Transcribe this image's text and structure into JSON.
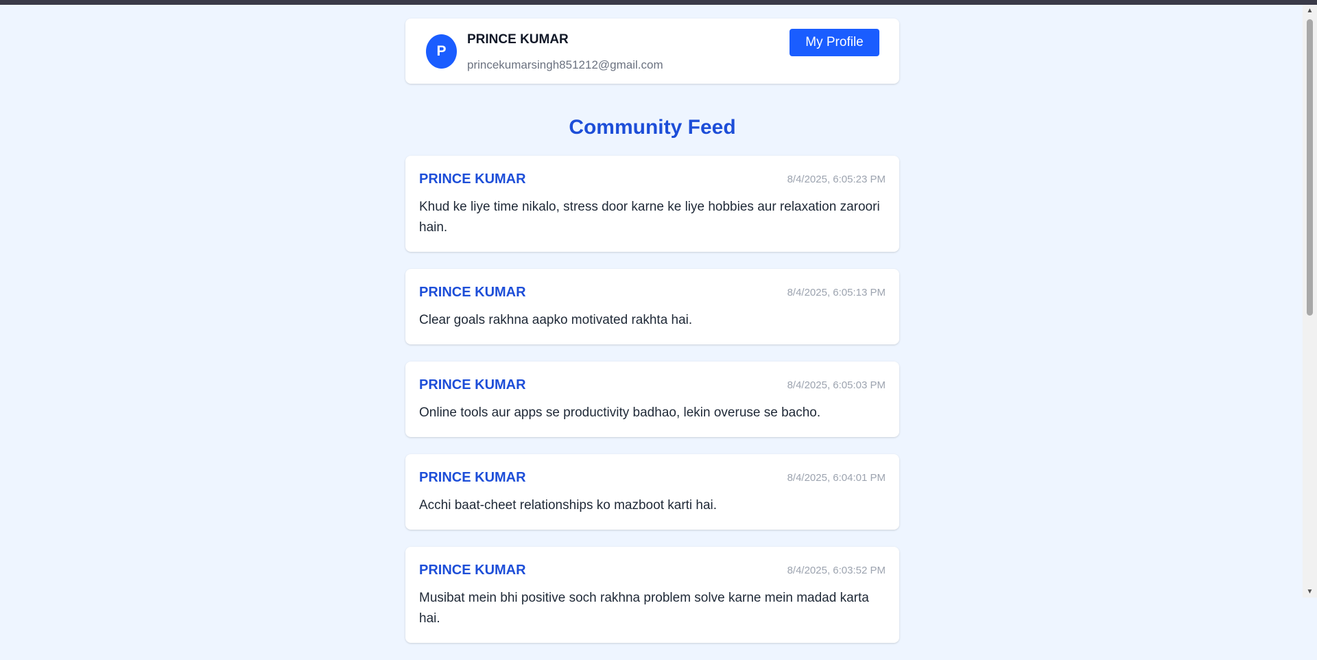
{
  "profile": {
    "avatar_initial": "P",
    "name": "PRINCE KUMAR",
    "email": "princekumarsingh851212@gmail.com",
    "button_label": "My Profile"
  },
  "feed": {
    "title": "Community Feed",
    "posts": [
      {
        "author": "PRINCE KUMAR",
        "timestamp": "8/4/2025, 6:05:23 PM",
        "content": "Khud ke liye time nikalo, stress door karne ke liye hobbies aur relaxation zaroori hain."
      },
      {
        "author": "PRINCE KUMAR",
        "timestamp": "8/4/2025, 6:05:13 PM",
        "content": "Clear goals rakhna aapko motivated rakhta hai."
      },
      {
        "author": "PRINCE KUMAR",
        "timestamp": "8/4/2025, 6:05:03 PM",
        "content": "Online tools aur apps se productivity badhao, lekin overuse se bacho."
      },
      {
        "author": "PRINCE KUMAR",
        "timestamp": "8/4/2025, 6:04:01 PM",
        "content": "Acchi baat-cheet relationships ko mazboot karti hai."
      },
      {
        "author": "PRINCE KUMAR",
        "timestamp": "8/4/2025, 6:03:52 PM",
        "content": "Musibat mein bhi positive soch rakhna problem solve karne mein madad karta hai."
      }
    ]
  },
  "icons": {
    "scroll_up": "scroll-up-arrow-icon",
    "scroll_down": "scroll-down-arrow-icon"
  },
  "colors": {
    "accent": "#1a5dff",
    "heading": "#1d4ed8",
    "background": "#eef5ff"
  }
}
